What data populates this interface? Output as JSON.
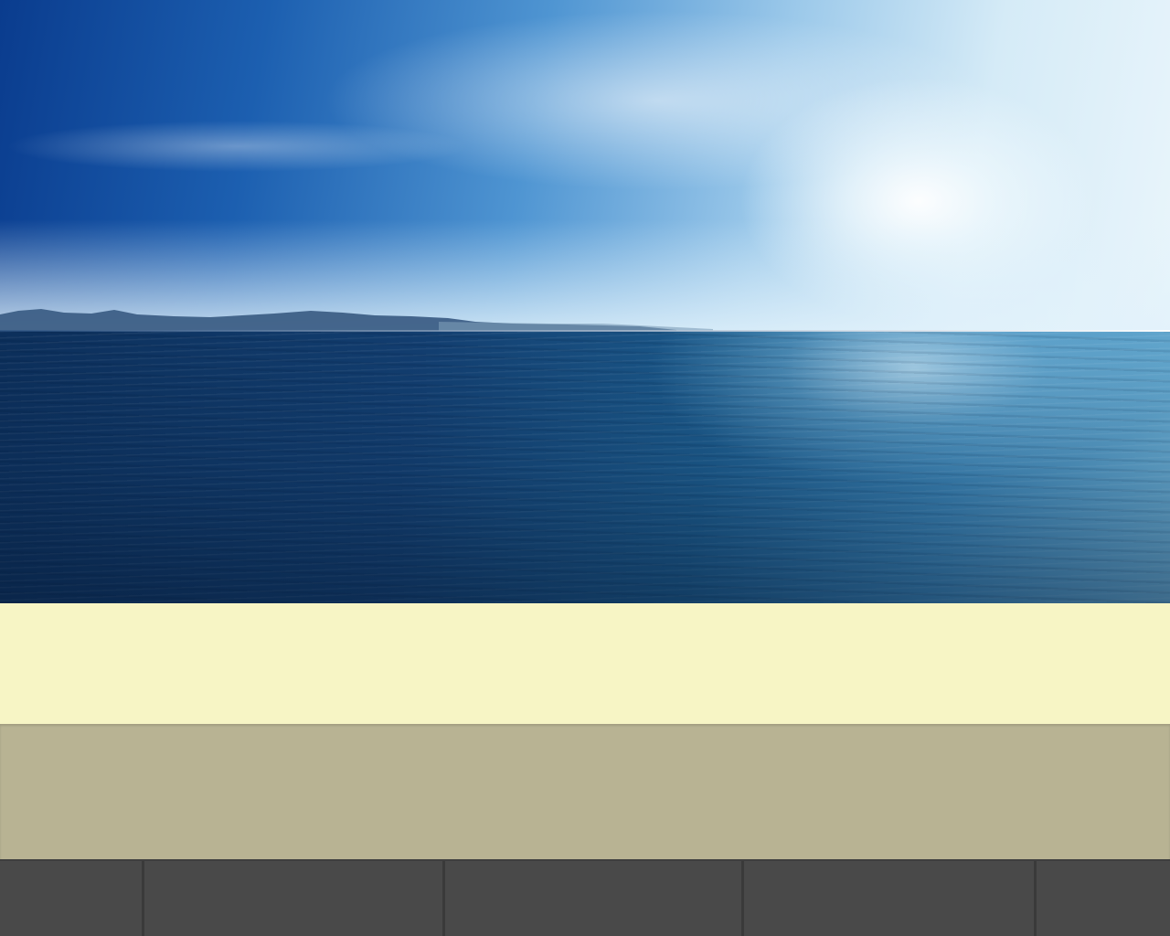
{
  "hero": {
    "image_description_icon": "sea-landscape-photo"
  },
  "nav": {
    "items": [
      {
        "label": ""
      },
      {
        "label": ""
      },
      {
        "label": ""
      },
      {
        "label": ""
      },
      {
        "label": ""
      }
    ]
  },
  "colors": {
    "cream_band": "#f7f5c5",
    "khaki_band": "#b8b393",
    "nav_bar": "#494949",
    "nav_divider": "#3a3a3a"
  }
}
